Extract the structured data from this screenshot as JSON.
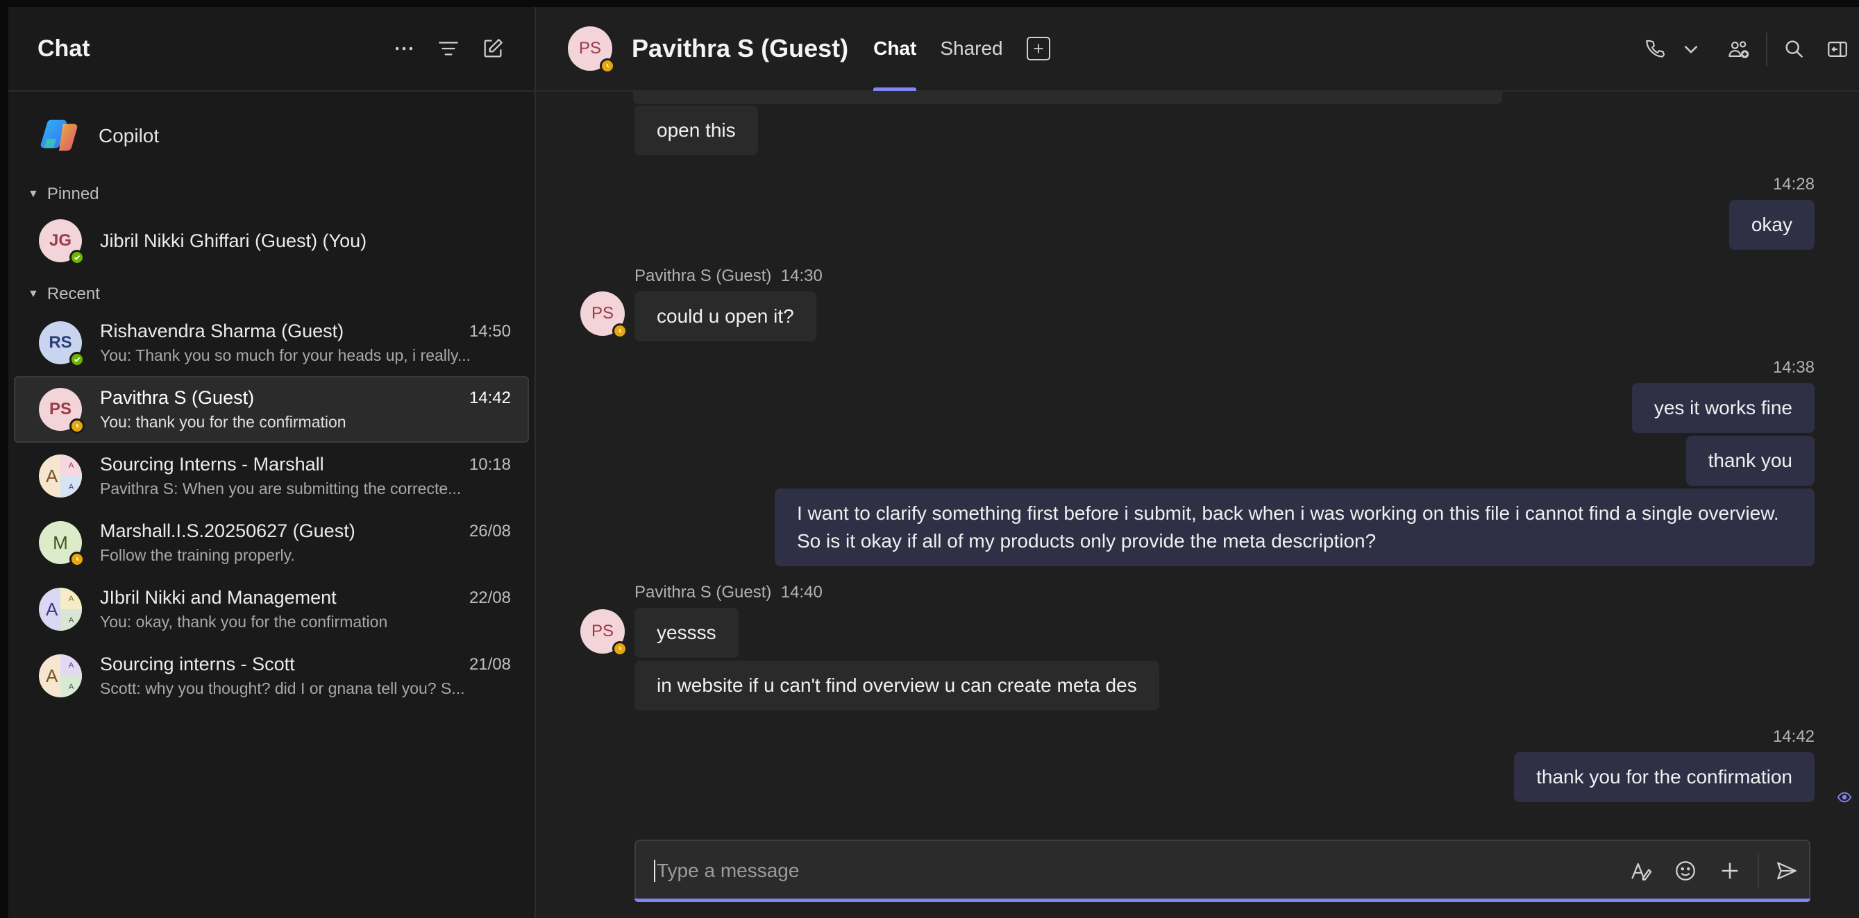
{
  "sidebar": {
    "title": "Chat",
    "copilot_label": "Copilot",
    "pinned_label": "Pinned",
    "recent_label": "Recent",
    "pinned": [
      {
        "initials": "JG",
        "name": "Jibril Nikki Ghiffari (Guest) (You)"
      }
    ],
    "recent": [
      {
        "initials": "RS",
        "name": "Rishavendra Sharma (Guest)",
        "time": "14:50",
        "preview": "You: Thank you so much for your heads up, i really..."
      },
      {
        "initials": "PS",
        "name": "Pavithra S (Guest)",
        "time": "14:42",
        "preview": "You: thank you for the confirmation"
      },
      {
        "initials": "A",
        "name": "Sourcing Interns - Marshall",
        "time": "10:18",
        "preview": "Pavithra S: When you are submitting the correcte..."
      },
      {
        "initials": "M",
        "name": "Marshall.I.S.20250627 (Guest)",
        "time": "26/08",
        "preview": "Follow the training properly."
      },
      {
        "initials": "A",
        "name": "JIbril Nikki and Management",
        "time": "22/08",
        "preview": "You: okay, thank you for the confirmation"
      },
      {
        "initials": "A",
        "name": "Sourcing interns - Scott",
        "time": "21/08",
        "preview": "Scott: why you thought? did I or gnana tell you? S..."
      }
    ],
    "group_mini": "A"
  },
  "header": {
    "initials": "PS",
    "title": "Pavithra S (Guest)",
    "tabs": [
      "Chat",
      "Shared"
    ]
  },
  "messages": {
    "m1": "open this",
    "t1": "14:28",
    "m2": "okay",
    "sender": "Pavithra S (Guest)",
    "t2": "14:30",
    "m3": "could u open it?",
    "t3": "14:38",
    "m4": "yes it works fine",
    "m5": "thank you",
    "m6": "I want to clarify something first before i submit, back when i was working on this file i cannot find a single overview. So is it okay if all of my products only provide the meta description?",
    "t4": "14:40",
    "m7": "yessss",
    "m8": "in website if u can't find overview u can create meta des",
    "t5": "14:42",
    "m9": "thank you for the confirmation",
    "avatar_initials": "PS"
  },
  "composer": {
    "placeholder": "Type a message"
  },
  "colors": {
    "accent": "#7f85f5",
    "available": "#6bb700",
    "away": "#e8a70e"
  }
}
